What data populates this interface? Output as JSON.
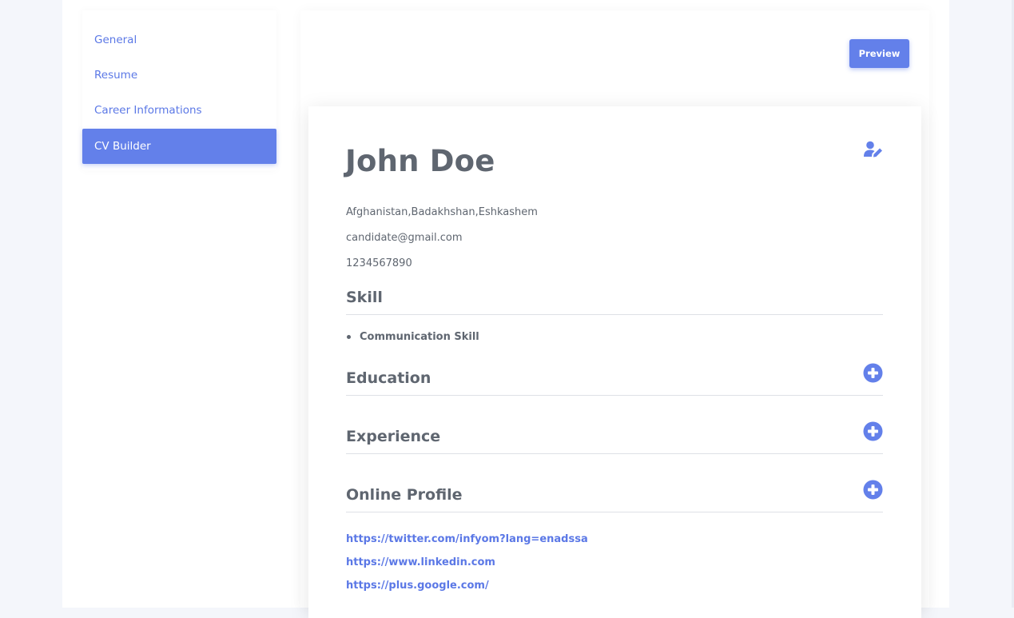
{
  "sidebar": {
    "items": [
      {
        "label": "General"
      },
      {
        "label": "Resume"
      },
      {
        "label": "Career Informations"
      },
      {
        "label": "CV Builder",
        "active": true
      }
    ]
  },
  "toolbar": {
    "preview_label": "Preview"
  },
  "cv": {
    "name": "John Doe",
    "location": "Afghanistan,Badakhshan,Eshkashem",
    "email": "candidate@gmail.com",
    "phone": "1234567890",
    "sections": {
      "skill": {
        "title": "Skill",
        "items": [
          "Communication Skill"
        ]
      },
      "education": {
        "title": "Education"
      },
      "experience": {
        "title": "Experience"
      },
      "online_profile": {
        "title": "Online Profile",
        "links": [
          "https://twitter.com/infyom?lang=enadssa",
          "https://www.linkedin.com",
          "https://plus.google.com/"
        ]
      }
    }
  },
  "icons": {
    "edit": "user-edit-icon",
    "add": "plus-circle-icon"
  },
  "colors": {
    "accent": "#6380ea",
    "link": "#5b78e6",
    "text": "#5f6670",
    "background": "#f4f6fb"
  }
}
